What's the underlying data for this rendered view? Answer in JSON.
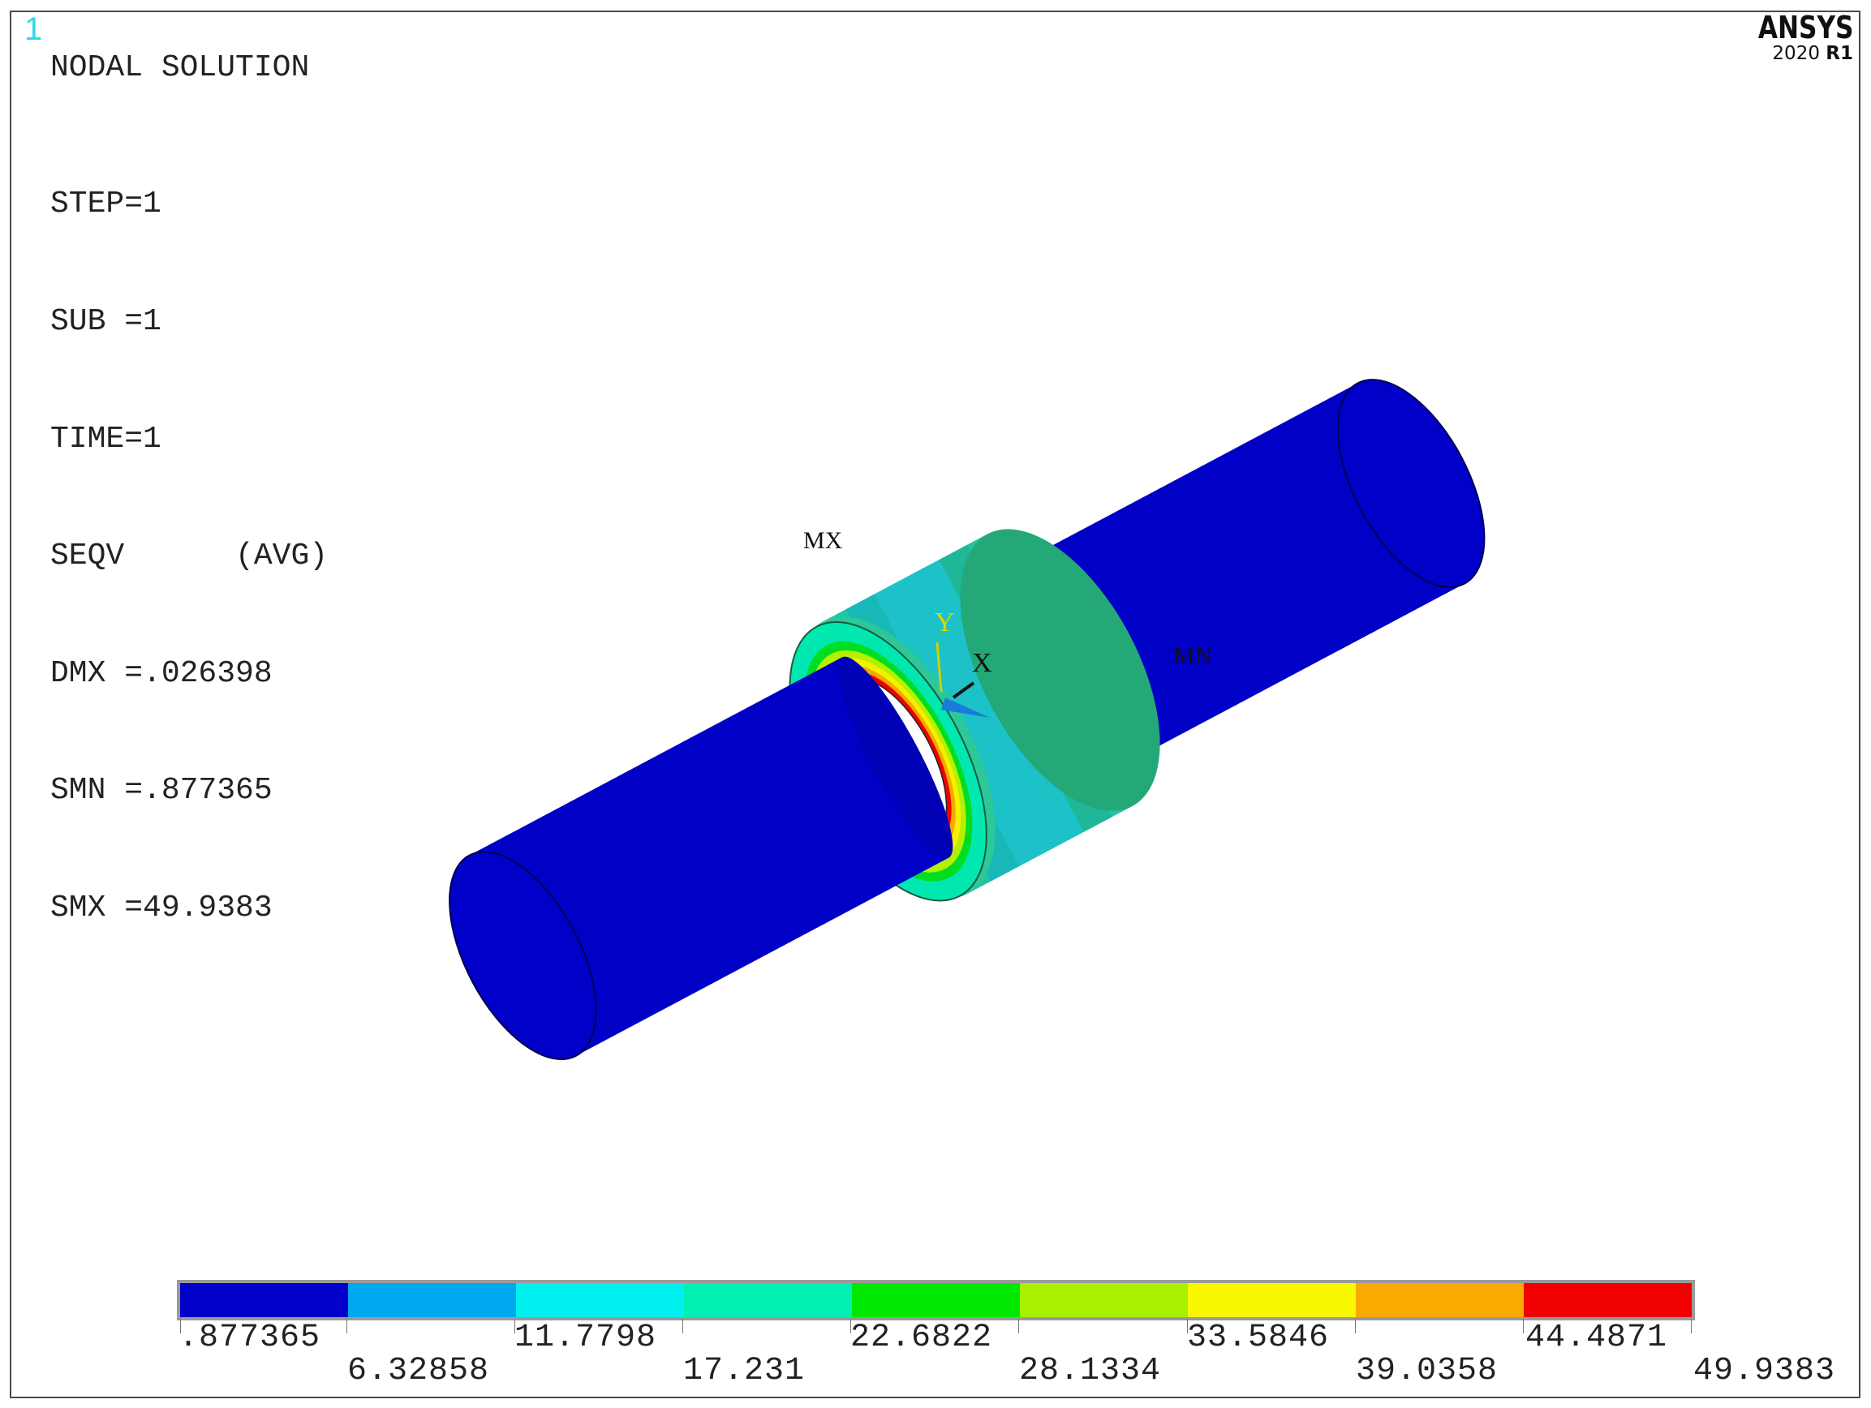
{
  "window": {
    "number": "1"
  },
  "brand": {
    "name": "ANSYS",
    "version_year": "2020",
    "version_release": "R1"
  },
  "plot": {
    "title": "NODAL SOLUTION",
    "info_lines": [
      "STEP=1",
      "SUB =1",
      "TIME=1",
      "SEQV      (AVG)",
      "DMX =.026398",
      "SMN =.877365",
      "SMX =49.9383"
    ]
  },
  "model": {
    "max_marker": "MX",
    "min_marker": "MN",
    "axis_x": "X",
    "axis_y": "Y"
  },
  "legend": {
    "colors": [
      "#0000c8",
      "#00a8f0",
      "#00f0f0",
      "#00f0b4",
      "#00e800",
      "#a8f000",
      "#f8f800",
      "#f8aa00",
      "#f00000"
    ],
    "upper_values": [
      ".877365",
      "11.7798",
      "22.6822",
      "33.5846",
      "44.4871"
    ],
    "lower_values": [
      "6.32858",
      "17.231",
      "28.1334",
      "39.0358",
      "49.9383"
    ]
  }
}
